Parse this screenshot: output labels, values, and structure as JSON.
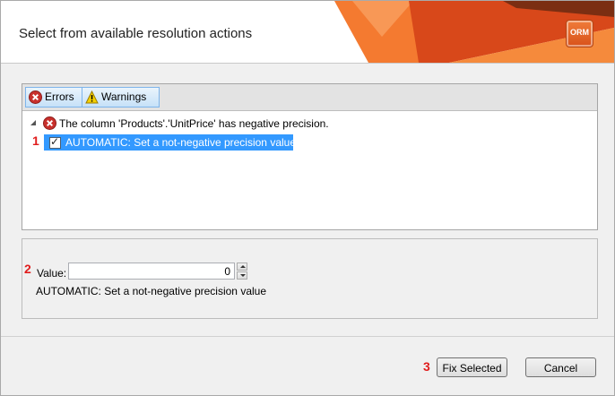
{
  "dialog": {
    "title": "Select from available resolution actions",
    "logo_text": "ORM"
  },
  "filters": {
    "errors_label": "Errors",
    "warnings_label": "Warnings"
  },
  "tree": {
    "error_message": "The column 'Products'.'UnitPrice' has negative precision.",
    "action_label": "AUTOMATIC: Set a not-negative precision value",
    "action_checked": true
  },
  "details": {
    "value_label": "Value:",
    "value": "0",
    "description": "AUTOMATIC: Set a not-negative precision value"
  },
  "markers": [
    "1",
    "2",
    "3"
  ],
  "buttons": {
    "fix_selected": "Fix Selected",
    "cancel": "Cancel"
  },
  "colors": {
    "selection": "#3399ff",
    "marker": "#e01c1c",
    "brand_orange": "#e8652a"
  },
  "icons": {
    "error": "error-x-circle-icon",
    "warning": "warning-triangle-icon",
    "expander": "expander-triangle-icon",
    "logo": "orm-logo-icon"
  }
}
